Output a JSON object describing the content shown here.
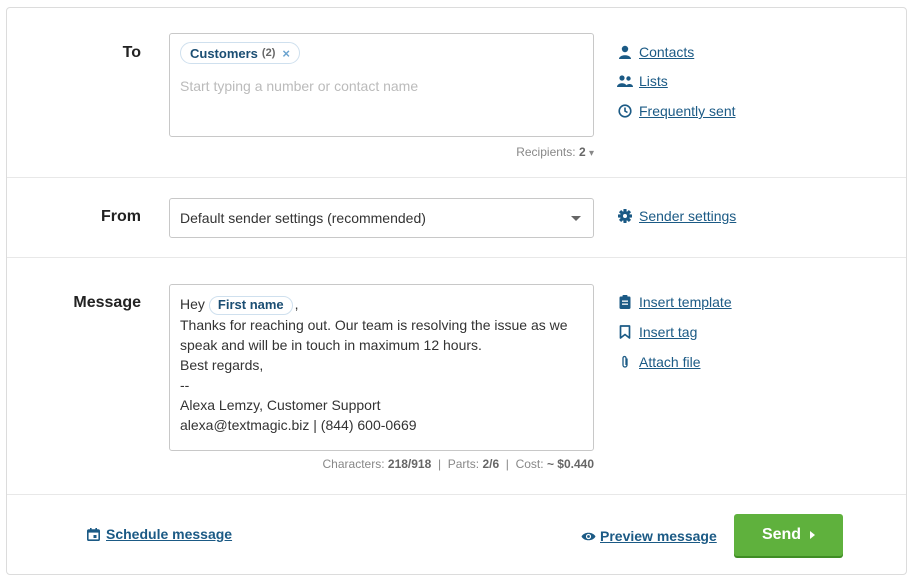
{
  "to": {
    "label": "To",
    "chip": {
      "name": "Customers",
      "count": "(2)",
      "remove": "×"
    },
    "placeholder": "Start typing a number or contact name",
    "recipients_label": "Recipients:",
    "recipients_count": "2",
    "recipients_caret": "▾",
    "links": [
      {
        "icon": "person-icon",
        "label": "Contacts"
      },
      {
        "icon": "people-icon",
        "label": "Lists"
      },
      {
        "icon": "clock-icon",
        "label": "Frequently sent"
      }
    ]
  },
  "from": {
    "label": "From",
    "selected": "Default sender settings (recommended)",
    "link": {
      "icon": "gear-icon",
      "label": "Sender settings"
    }
  },
  "message": {
    "label": "Message",
    "greeting": "Hey",
    "tag": "First name",
    "after_tag": ",",
    "lines": [
      "Thanks for reaching out. Our team is resolving the issue as we",
      "speak and will be in touch in maximum 12 hours.",
      "Best regards,",
      "--",
      "Alexa Lemzy, Customer Support",
      "alexa@textmagic.biz | (844) 600-0669"
    ],
    "stats": {
      "characters_label": "Characters:",
      "characters_value": "218/918",
      "parts_label": "Parts:",
      "parts_value": "2/6",
      "cost_label": "Cost:",
      "cost_value": "~ $0.440",
      "sep": "|"
    },
    "links": [
      {
        "icon": "clipboard-icon",
        "label": "Insert template"
      },
      {
        "icon": "bookmark-icon",
        "label": "Insert tag"
      },
      {
        "icon": "paperclip-icon",
        "label": "Attach file"
      }
    ]
  },
  "footer": {
    "schedule_label": "Schedule message",
    "preview_label": "Preview message",
    "send_label": "Send"
  },
  "colors": {
    "link": "#1b5a85",
    "send": "#5fb13d"
  }
}
